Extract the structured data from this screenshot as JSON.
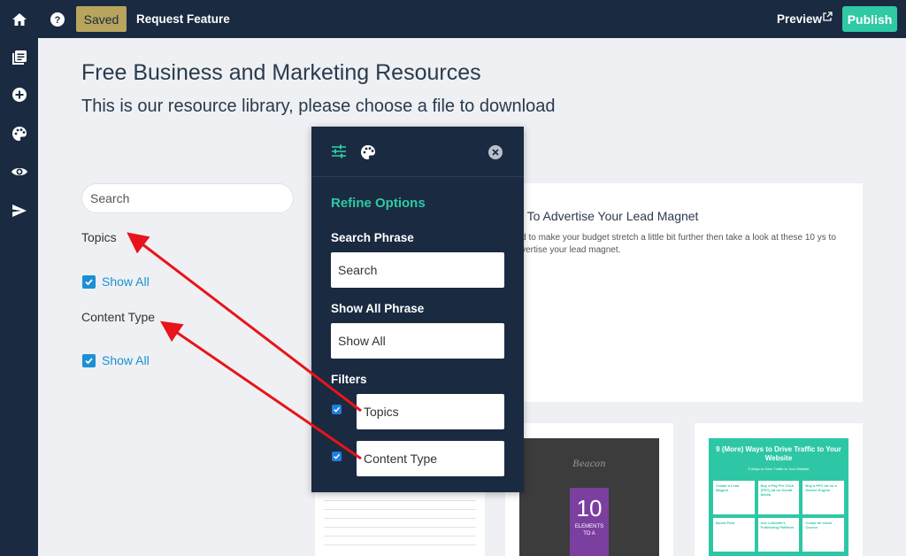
{
  "topbar": {
    "saved_label": "Saved",
    "request_label": "Request Feature",
    "preview_label": "Preview",
    "publish_label": "Publish"
  },
  "page": {
    "title": "Free Business and Marketing Resources",
    "subtitle": "This is our resource library, please choose a file to download",
    "search_placeholder": "Search",
    "topics_label": "Topics",
    "topics_show_all": "Show All",
    "content_type_label": "Content Type",
    "content_type_show_all": "Show All"
  },
  "article": {
    "title": "ys To Advertise Your Lead Magnet",
    "excerpt": "eed to make your budget stretch a little bit further then take a look at these 10 ys to advertise your lead magnet."
  },
  "thumbs": {
    "beacon": "Beacon",
    "big_number": "10",
    "elements": "ELEMENTS",
    "to_a": "TO A",
    "t3_title": "9 (More) Ways to Drive Traffic to Your Website",
    "t3_sub": "5 Ways to Drive Traffic to Your Website",
    "t3_cells": [
      "Create a Lead Magnet",
      "Buy a Pay Per Click (PPC) ad on Social Media",
      "Buy a PPC ad on a Search Engine",
      "Boost Post",
      "Use LinkedIn's Publishing Platform",
      "Create an email Course"
    ]
  },
  "panel": {
    "refine_title": "Refine Options",
    "search_phrase_label": "Search Phrase",
    "search_phrase_value": "Search",
    "show_all_label": "Show All Phrase",
    "show_all_value": "Show All",
    "filters_label": "Filters",
    "filter_topics": "Topics",
    "filter_content_type": "Content Type"
  },
  "colors": {
    "navy": "#1a2a41",
    "accent": "#2fc9a5",
    "saved": "#b8a45d",
    "arrow": "#e8141b"
  },
  "icons": {
    "sidebar": [
      "home-icon",
      "pages-icon",
      "add-icon",
      "palette-icon",
      "eye-icon",
      "send-icon"
    ],
    "topbar": [
      "help-icon",
      "external-link-icon"
    ],
    "panel": [
      "sliders-icon",
      "palette-icon",
      "close-icon"
    ]
  }
}
